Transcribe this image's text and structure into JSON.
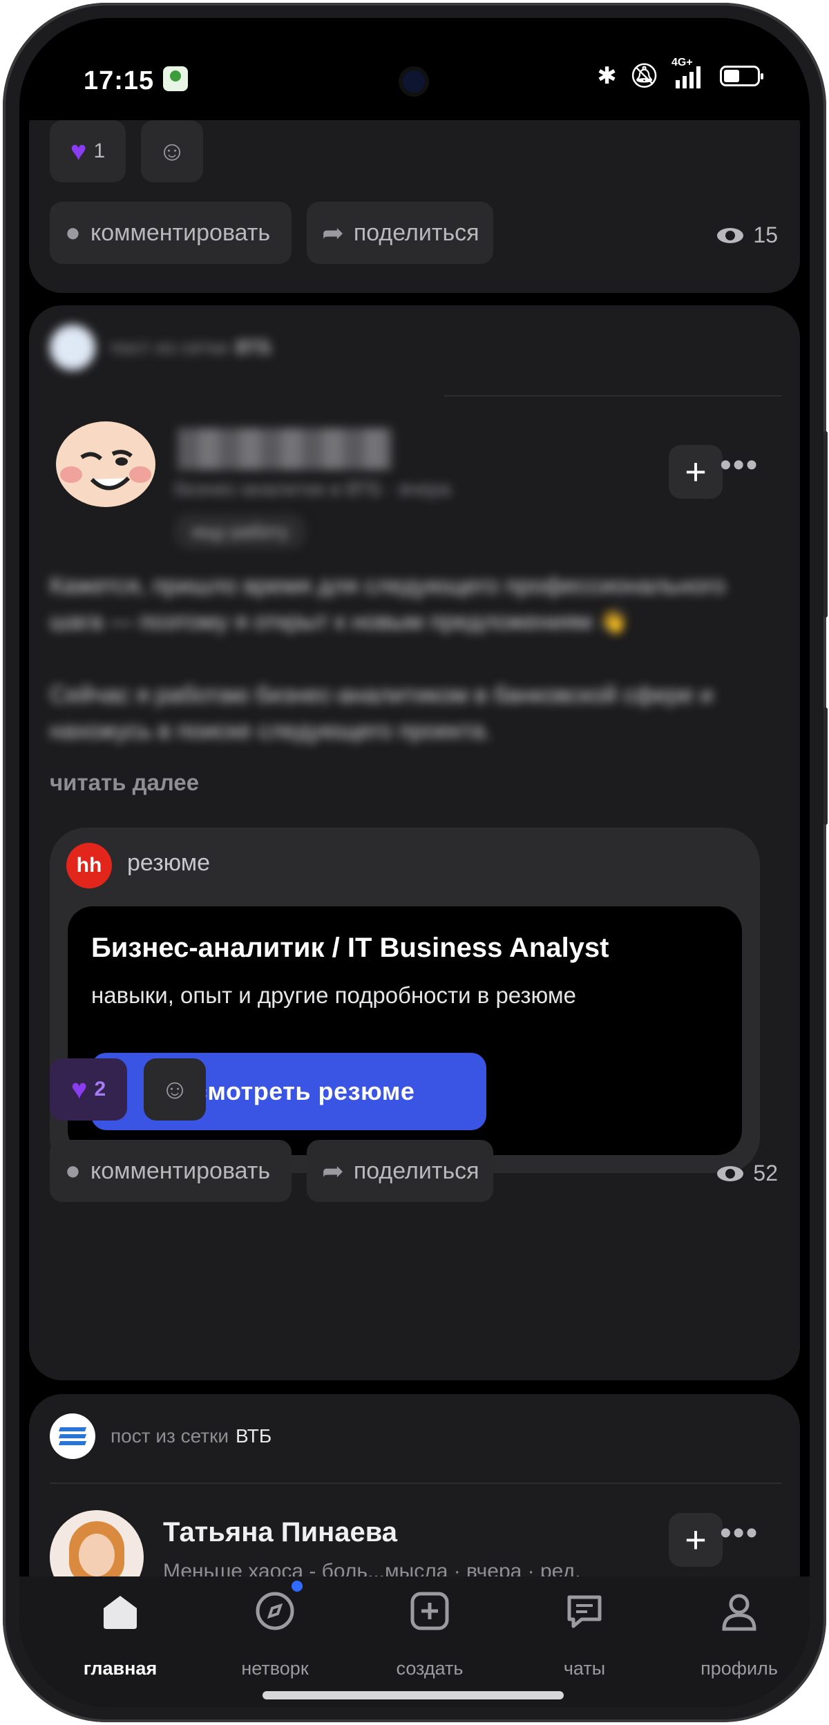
{
  "status_bar": {
    "time": "17:15",
    "network": "4G+",
    "icons": [
      "bluetooth-icon",
      "bell-muted-icon",
      "signal-icon",
      "battery-icon"
    ]
  },
  "post_top": {
    "reaction_count": "1",
    "comment_label": "комментировать",
    "share_label": "поделиться",
    "views": "15"
  },
  "post_vtb": {
    "source_prefix": "пост из сетки",
    "source_name": "ВТБ",
    "author_subtitle": "бизнес-аналитик в ВТБ · вчера",
    "badge": "ищу работу",
    "paragraph_1": "Кажется, пришло время для следующего профессионального шага — поэтому я открыт к новым предложениям 👋",
    "paragraph_2": "Сейчас я работаю бизнес-аналитиком в банковской сфере и нахожусь в поиске следующего проекта.",
    "read_more": "читать далее",
    "resume_card": {
      "logo": "hh",
      "tag": "резюме",
      "title": "Бизнес-аналитик / IT Business Analyst",
      "subtitle": "навыки, опыт и другие подробности в резюме",
      "button": "посмотреть резюме"
    },
    "reaction_count": "2",
    "comment_label": "комментировать",
    "share_label": "поделиться",
    "views": "52"
  },
  "post_bottom": {
    "source_prefix": "пост из сетки",
    "source_name": "ВТБ",
    "author_name": "Татьяна Пинаева",
    "author_subtitle": "Меньше хаоса - боль...мысла · вчера · ред."
  },
  "tabbar": {
    "tabs": [
      {
        "label": "главная",
        "icon": "home-icon"
      },
      {
        "label": "нетворк",
        "icon": "compass-icon"
      },
      {
        "label": "создать",
        "icon": "add-square-icon"
      },
      {
        "label": "чаты",
        "icon": "chat-icon"
      },
      {
        "label": "профиль",
        "icon": "profile-icon"
      }
    ]
  },
  "colors": {
    "accent": "#3a55e3",
    "like": "#8a3cf0",
    "hh": "#e2261c",
    "notification_dot": "#2f6bff"
  }
}
